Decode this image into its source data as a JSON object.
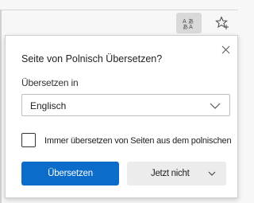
{
  "toolbar": {
    "translate_icon": "translate-icon",
    "favorite_icon": "favorite-star-add-icon"
  },
  "popup": {
    "title": "Seite von Polnisch Übersetzen?",
    "close_icon": "close-icon",
    "target_label": "Übersetzen in",
    "target_value": "Englisch",
    "always_translate_label": "Immer übersetzen von Seiten aus dem polnischen",
    "always_translate_checked": false,
    "translate_button": "Übersetzen",
    "not_now_button": "Jetzt nicht"
  },
  "colors": {
    "accent": "#0b6cc9",
    "secondary_button": "#ececec",
    "active_icon_bg": "#d9d9d9"
  }
}
